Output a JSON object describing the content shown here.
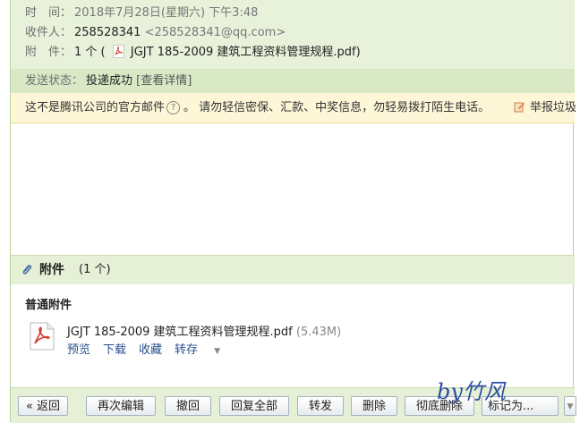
{
  "header": {
    "time_label": "时　间：",
    "time_value": "2018年7月28日(星期六) 下午3:48",
    "recipient_label": "收件人：",
    "recipient_name": "258528341",
    "recipient_email": "<258528341@qq.com>",
    "attachment_label": "附　件：",
    "attachment_count": "1 个 (",
    "attachment_name": "JGJT 185-2009 建筑工程资料管理规程.pdf)",
    "status_label": "发送状态：",
    "status_value": "投递成功",
    "status_detail": "[查看详情]"
  },
  "warning": {
    "text_a": "这不是腾讯公司的官方邮件",
    "help": "?",
    "text_b": "。 请勿轻信密保、汇款、中奖信息，勿轻易拨打陌生电话。",
    "report": "举报垃圾"
  },
  "attachments": {
    "title": "附件",
    "count": "(1 个)",
    "section": "普通附件",
    "file_name": "JGJT 185-2009 建筑工程资料管理规程.pdf",
    "file_size": "(5.43M)",
    "actions": {
      "preview": "预览",
      "download": "下载",
      "save": "收藏",
      "forward": "转存"
    },
    "forward_caret": "▼"
  },
  "toolbar": {
    "back": "« 返回",
    "edit_again": "再次编辑",
    "withdraw": "撤回",
    "reply_all": "回复全部",
    "forward": "转发",
    "delete": "删除",
    "delete_permanently": "彻底删除",
    "mark_as": "标记为...",
    "more_caret": "▼"
  },
  "signature": "by竹风",
  "colors": {
    "header_bg": "#e8f2da",
    "status_bg": "#d9e8c5",
    "warn_bg": "#fdf7d8",
    "link": "#2a4f8f"
  }
}
